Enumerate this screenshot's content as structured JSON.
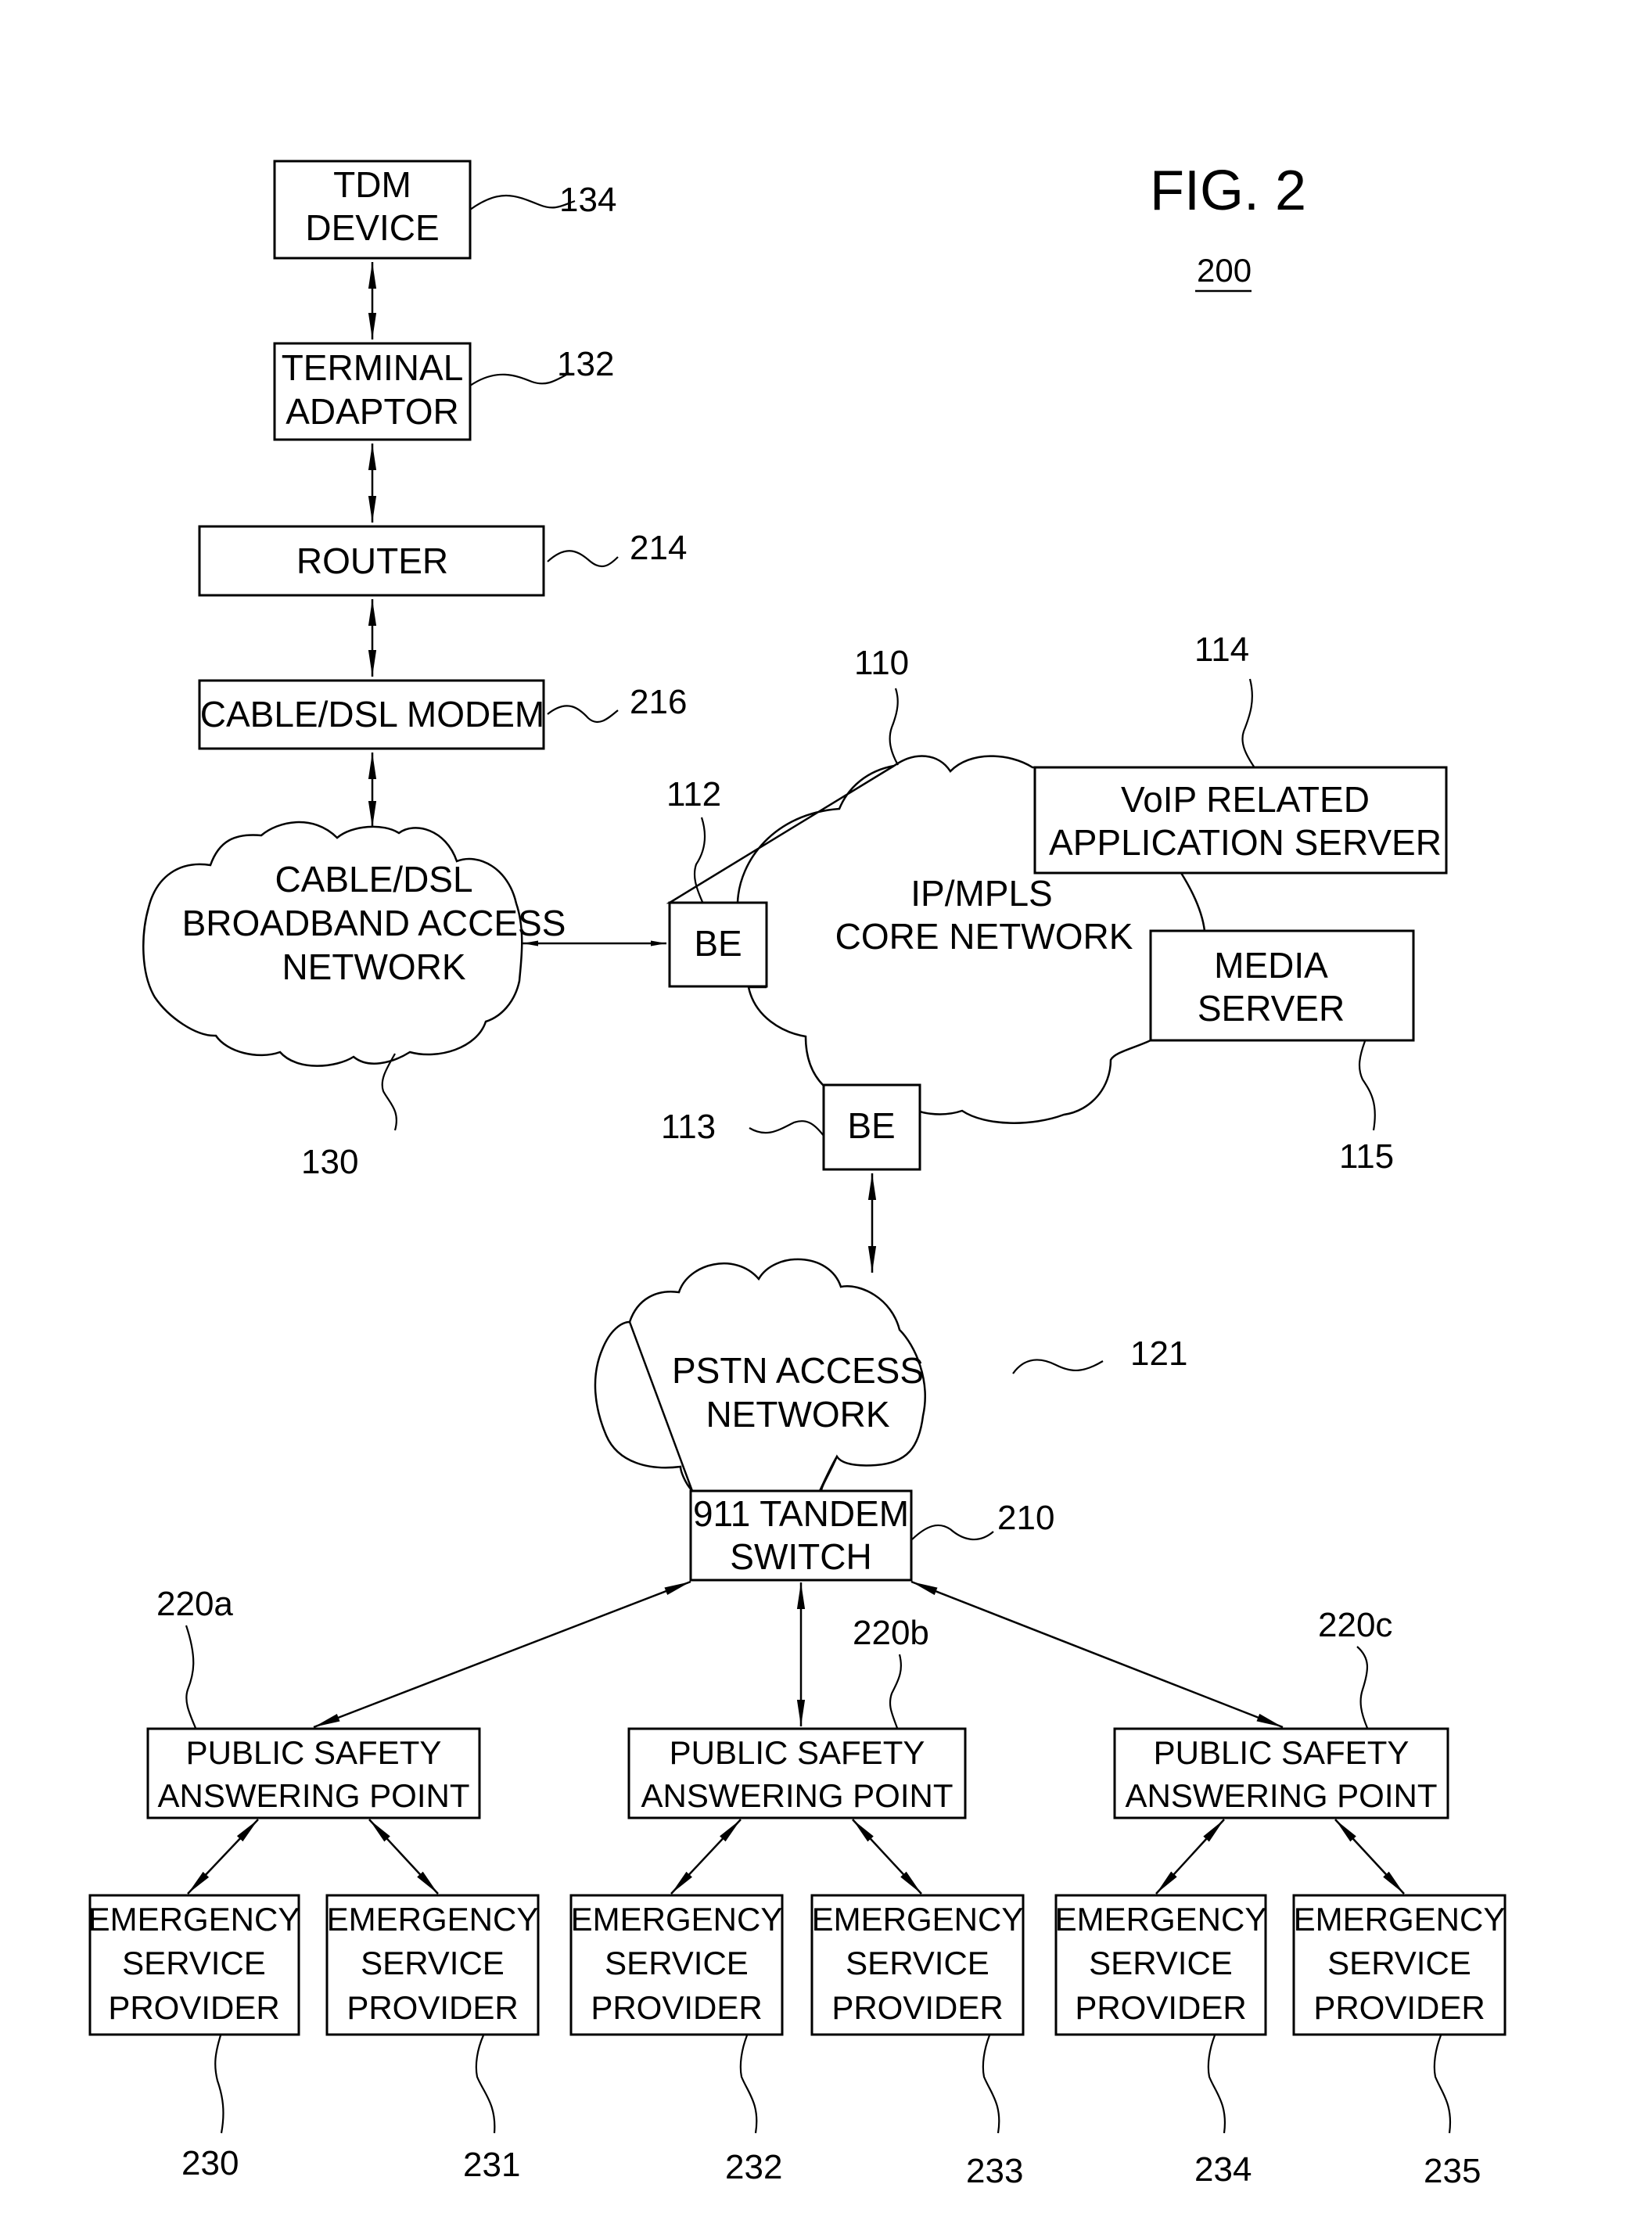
{
  "figure": {
    "title": "FIG. 2",
    "number": "200"
  },
  "nodes": {
    "tdm_device": {
      "lines": [
        "TDM",
        "DEVICE"
      ],
      "ref": "134"
    },
    "terminal_adaptor": {
      "lines": [
        "TERMINAL",
        "ADAPTOR"
      ],
      "ref": "132"
    },
    "router": {
      "lines": [
        "ROUTER"
      ],
      "ref": "214"
    },
    "cable_modem": {
      "lines": [
        "CABLE/DSL MODEM"
      ],
      "ref": "216"
    },
    "broadband_network": {
      "lines": [
        "CABLE/DSL",
        "BROADBAND ACCESS",
        "NETWORK"
      ],
      "ref": "130"
    },
    "be_112": {
      "lines": [
        "BE"
      ],
      "ref": "112"
    },
    "core_network": {
      "lines": [
        "IP/MPLS",
        "CORE NETWORK"
      ],
      "ref": "110"
    },
    "voip_server": {
      "lines": [
        "VoIP RELATED",
        "APPLICATION SERVER"
      ],
      "ref": "114"
    },
    "media_server": {
      "lines": [
        "MEDIA",
        "SERVER"
      ],
      "ref": "115"
    },
    "be_113": {
      "lines": [
        "BE"
      ],
      "ref": "113"
    },
    "pstn_network": {
      "lines": [
        "PSTN ACCESS",
        "NETWORK"
      ],
      "ref": "121"
    },
    "tandem_switch": {
      "lines": [
        "911 TANDEM",
        "SWITCH"
      ],
      "ref": "210"
    },
    "psap_a": {
      "lines": [
        "PUBLIC SAFETY",
        "ANSWERING POINT"
      ],
      "ref": "220a"
    },
    "psap_b": {
      "lines": [
        "PUBLIC SAFETY",
        "ANSWERING POINT"
      ],
      "ref": "220b"
    },
    "psap_c": {
      "lines": [
        "PUBLIC SAFETY",
        "ANSWERING POINT"
      ],
      "ref": "220c"
    },
    "esp_230": {
      "lines": [
        "EMERGENCY",
        "SERVICE",
        "PROVIDER"
      ],
      "ref": "230"
    },
    "esp_231": {
      "lines": [
        "EMERGENCY",
        "SERVICE",
        "PROVIDER"
      ],
      "ref": "231"
    },
    "esp_232": {
      "lines": [
        "EMERGENCY",
        "SERVICE",
        "PROVIDER"
      ],
      "ref": "232"
    },
    "esp_233": {
      "lines": [
        "EMERGENCY",
        "SERVICE",
        "PROVIDER"
      ],
      "ref": "233"
    },
    "esp_234": {
      "lines": [
        "EMERGENCY",
        "SERVICE",
        "PROVIDER"
      ],
      "ref": "234"
    },
    "esp_235": {
      "lines": [
        "EMERGENCY",
        "SERVICE",
        "PROVIDER"
      ],
      "ref": "235"
    }
  },
  "connections": [
    {
      "from": "tdm_device",
      "to": "terminal_adaptor",
      "bidirectional": true
    },
    {
      "from": "terminal_adaptor",
      "to": "router",
      "bidirectional": true
    },
    {
      "from": "router",
      "to": "cable_modem",
      "bidirectional": true
    },
    {
      "from": "cable_modem",
      "to": "broadband_network",
      "bidirectional": true
    },
    {
      "from": "broadband_network",
      "to": "be_112",
      "bidirectional": true
    },
    {
      "from": "be_113",
      "to": "pstn_network",
      "bidirectional": true
    },
    {
      "from": "tandem_switch",
      "to": "psap_a",
      "bidirectional": true
    },
    {
      "from": "tandem_switch",
      "to": "psap_b",
      "bidirectional": true
    },
    {
      "from": "tandem_switch",
      "to": "psap_c",
      "bidirectional": true
    },
    {
      "from": "psap_a",
      "to": "esp_230",
      "bidirectional": true
    },
    {
      "from": "psap_a",
      "to": "esp_231",
      "bidirectional": true
    },
    {
      "from": "psap_b",
      "to": "esp_232",
      "bidirectional": true
    },
    {
      "from": "psap_b",
      "to": "esp_233",
      "bidirectional": true
    },
    {
      "from": "psap_c",
      "to": "esp_234",
      "bidirectional": true
    },
    {
      "from": "psap_c",
      "to": "esp_235",
      "bidirectional": true
    }
  ]
}
